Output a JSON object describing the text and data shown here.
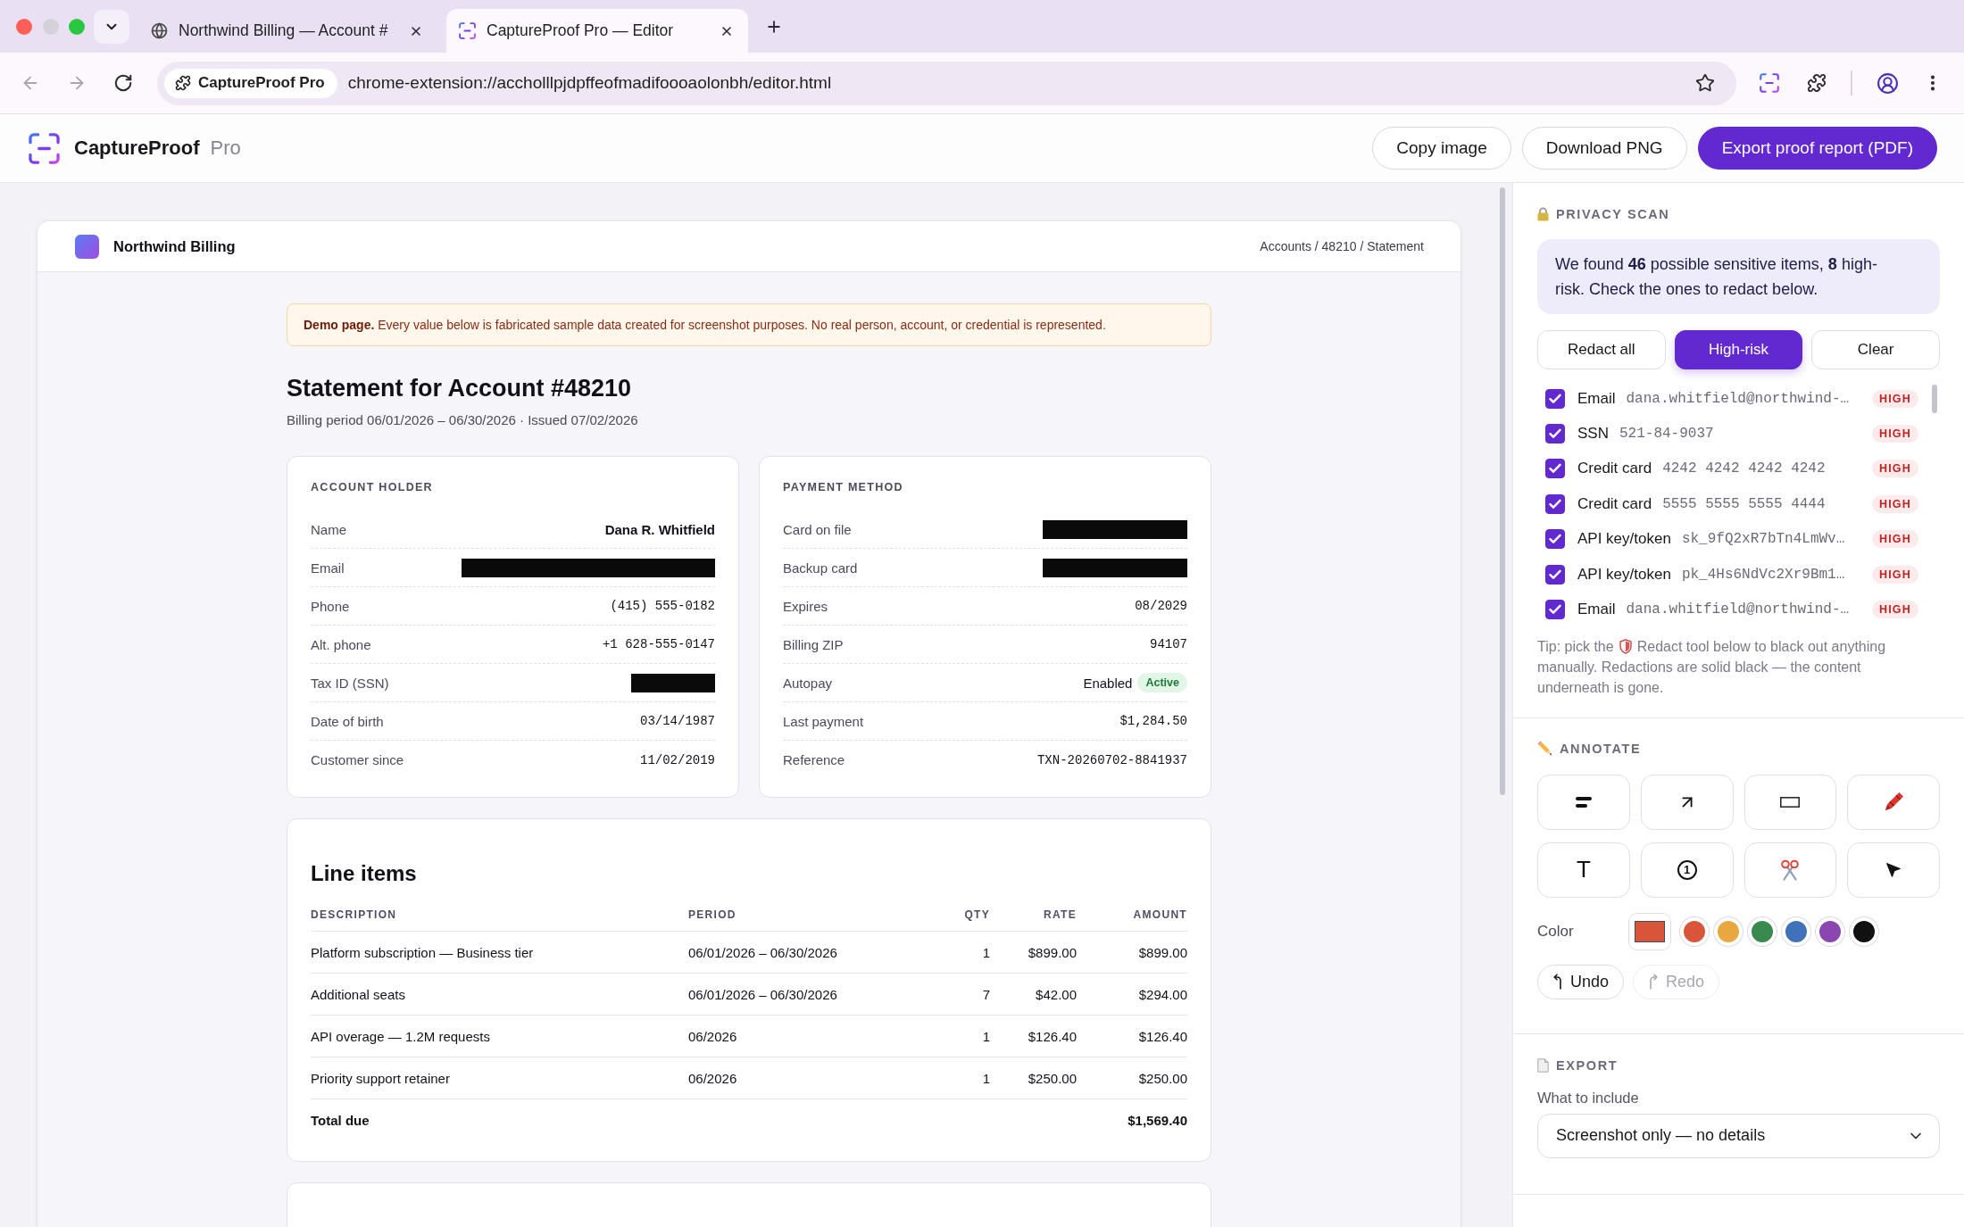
{
  "browser": {
    "tabs": [
      {
        "title": "Northwind Billing — Account #",
        "kind": "globe",
        "selected": false
      },
      {
        "title": "CaptureProof Pro — Editor",
        "kind": "extension",
        "selected": true
      }
    ],
    "address_bar": {
      "site_chip": "CaptureProof Pro",
      "url": "chrome-extension://accholllpjdpffeofmadifoooaolonbh/editor.html"
    }
  },
  "app_header": {
    "brand": "CaptureProof",
    "edition": "Pro",
    "actions": [
      {
        "label": "Copy image",
        "kind": "secondary"
      },
      {
        "label": "Download PNG",
        "kind": "secondary"
      },
      {
        "label": "Export proof report (PDF)",
        "kind": "primary"
      }
    ]
  },
  "document": {
    "site_name": "Northwind Billing",
    "breadcrumb": "Accounts / 48210 / Statement",
    "notice": "**Demo page.** Every value below is fabricated sample data created for screenshot purposes. No real person, account, or credential is represented.",
    "title": "Statement for Account #48210",
    "subtitle": "Billing period 06/01/2026 – 06/30/2026 · Issued 07/02/2026",
    "panels": [
      {
        "heading": "ACCOUNT HOLDER",
        "rows": [
          {
            "label": "Name",
            "kind": "name",
            "value": "Dana R. Whitfield"
          },
          {
            "label": "Email",
            "kind": "redacted"
          },
          {
            "label": "Phone",
            "kind": "mono",
            "value": "(415) 555-0182"
          },
          {
            "label": "Alt. phone",
            "kind": "mono",
            "value": "+1 628-555-0147"
          },
          {
            "label": "Tax ID (SSN)",
            "kind": "redacted"
          },
          {
            "label": "Date of birth",
            "kind": "mono",
            "value": "03/14/1987"
          },
          {
            "label": "Customer since",
            "kind": "mono",
            "value": "11/02/2019"
          }
        ]
      },
      {
        "heading": "PAYMENT METHOD",
        "rows": [
          {
            "label": "Card on file",
            "kind": "redacted"
          },
          {
            "label": "Backup card",
            "kind": "redacted"
          },
          {
            "label": "Expires",
            "kind": "mono",
            "value": "08/2029"
          },
          {
            "label": "Billing ZIP",
            "kind": "mono",
            "value": "94107"
          },
          {
            "label": "Autopay",
            "kind": "status",
            "value": "Enabled",
            "badge": "Active"
          },
          {
            "label": "Last payment",
            "kind": "mono",
            "value": "$1,284.50"
          },
          {
            "label": "Reference",
            "kind": "mono",
            "value": "TXN-20260702-8841937"
          }
        ]
      }
    ],
    "line_items": {
      "heading": "Line items",
      "columns": [
        "DESCRIPTION",
        "PERIOD",
        "QTY",
        "RATE",
        "AMOUNT"
      ],
      "rows": [
        [
          "Platform subscription — Business tier",
          "06/01/2026 – 06/30/2026",
          "1",
          "$899.00",
          "$899.00"
        ],
        [
          "Additional seats",
          "06/01/2026 – 06/30/2026",
          "7",
          "$42.00",
          "$294.00"
        ],
        [
          "API overage — 1.2M requests",
          "06/2026",
          "1",
          "$126.40",
          "$126.40"
        ],
        [
          "Priority support retainer",
          "06/2026",
          "1",
          "$250.00",
          "$250.00"
        ]
      ],
      "total": {
        "label": "Total due",
        "amount": "$1,569.40"
      }
    }
  },
  "privacy_scan": {
    "heading": "PRIVACY SCAN",
    "summary": "We found **46** possible sensitive items, **8** high-risk. Check the ones to redact below.",
    "filters": [
      {
        "label": "Redact all",
        "selected": false
      },
      {
        "label": "High-risk",
        "selected": true
      },
      {
        "label": "Clear",
        "selected": false
      }
    ],
    "items": [
      {
        "type": "Email",
        "value": "dana.whitfield@northwind-…",
        "risk": "HIGH",
        "checked": true
      },
      {
        "type": "SSN",
        "value": "521-84-9037",
        "risk": "HIGH",
        "checked": true
      },
      {
        "type": "Credit card",
        "value": "4242 4242 4242 4242",
        "risk": "HIGH",
        "checked": true
      },
      {
        "type": "Credit card",
        "value": "5555 5555 5555 4444",
        "risk": "HIGH",
        "checked": true
      },
      {
        "type": "API key/token",
        "value": "sk_9fQ2xR7bTn4LmWv…",
        "risk": "HIGH",
        "checked": true
      },
      {
        "type": "API key/token",
        "value": "pk_4Hs6NdVc2Xr9Bm1…",
        "risk": "HIGH",
        "checked": true
      },
      {
        "type": "Email",
        "value": "dana.whitfield@northwind-…",
        "risk": "HIGH",
        "checked": true
      }
    ],
    "tip": {
      "lead": "Tip: pick the",
      "text": "Redact tool below to black out anything",
      "rest": "manually. Redactions are solid black — the content underneath is gone."
    }
  },
  "annotate": {
    "heading": "ANNOTATE",
    "tools": [
      {
        "kind": "redact"
      },
      {
        "kind": "arrow"
      },
      {
        "kind": "rectangle"
      },
      {
        "kind": "crayon"
      },
      {
        "kind": "text",
        "label": "T"
      },
      {
        "kind": "step",
        "label": "1"
      },
      {
        "kind": "cut"
      },
      {
        "kind": "select"
      }
    ],
    "color_label": "Color",
    "current": {
      "color": "#d9553a"
    },
    "swatches": [
      {
        "color": "#d9553a"
      },
      {
        "color": "#e9a83f"
      },
      {
        "color": "#3a8a4f"
      },
      {
        "color": "#3f72b8"
      },
      {
        "color": "#8a47b0"
      },
      {
        "color": "#111111"
      }
    ],
    "history": [
      {
        "kind": "undo",
        "label": "Undo",
        "disabled": false
      },
      {
        "kind": "redo",
        "label": "Redo",
        "disabled": true
      }
    ]
  },
  "export": {
    "heading": "EXPORT",
    "field_label": "What to include",
    "selection": "Screenshot only — no details"
  }
}
